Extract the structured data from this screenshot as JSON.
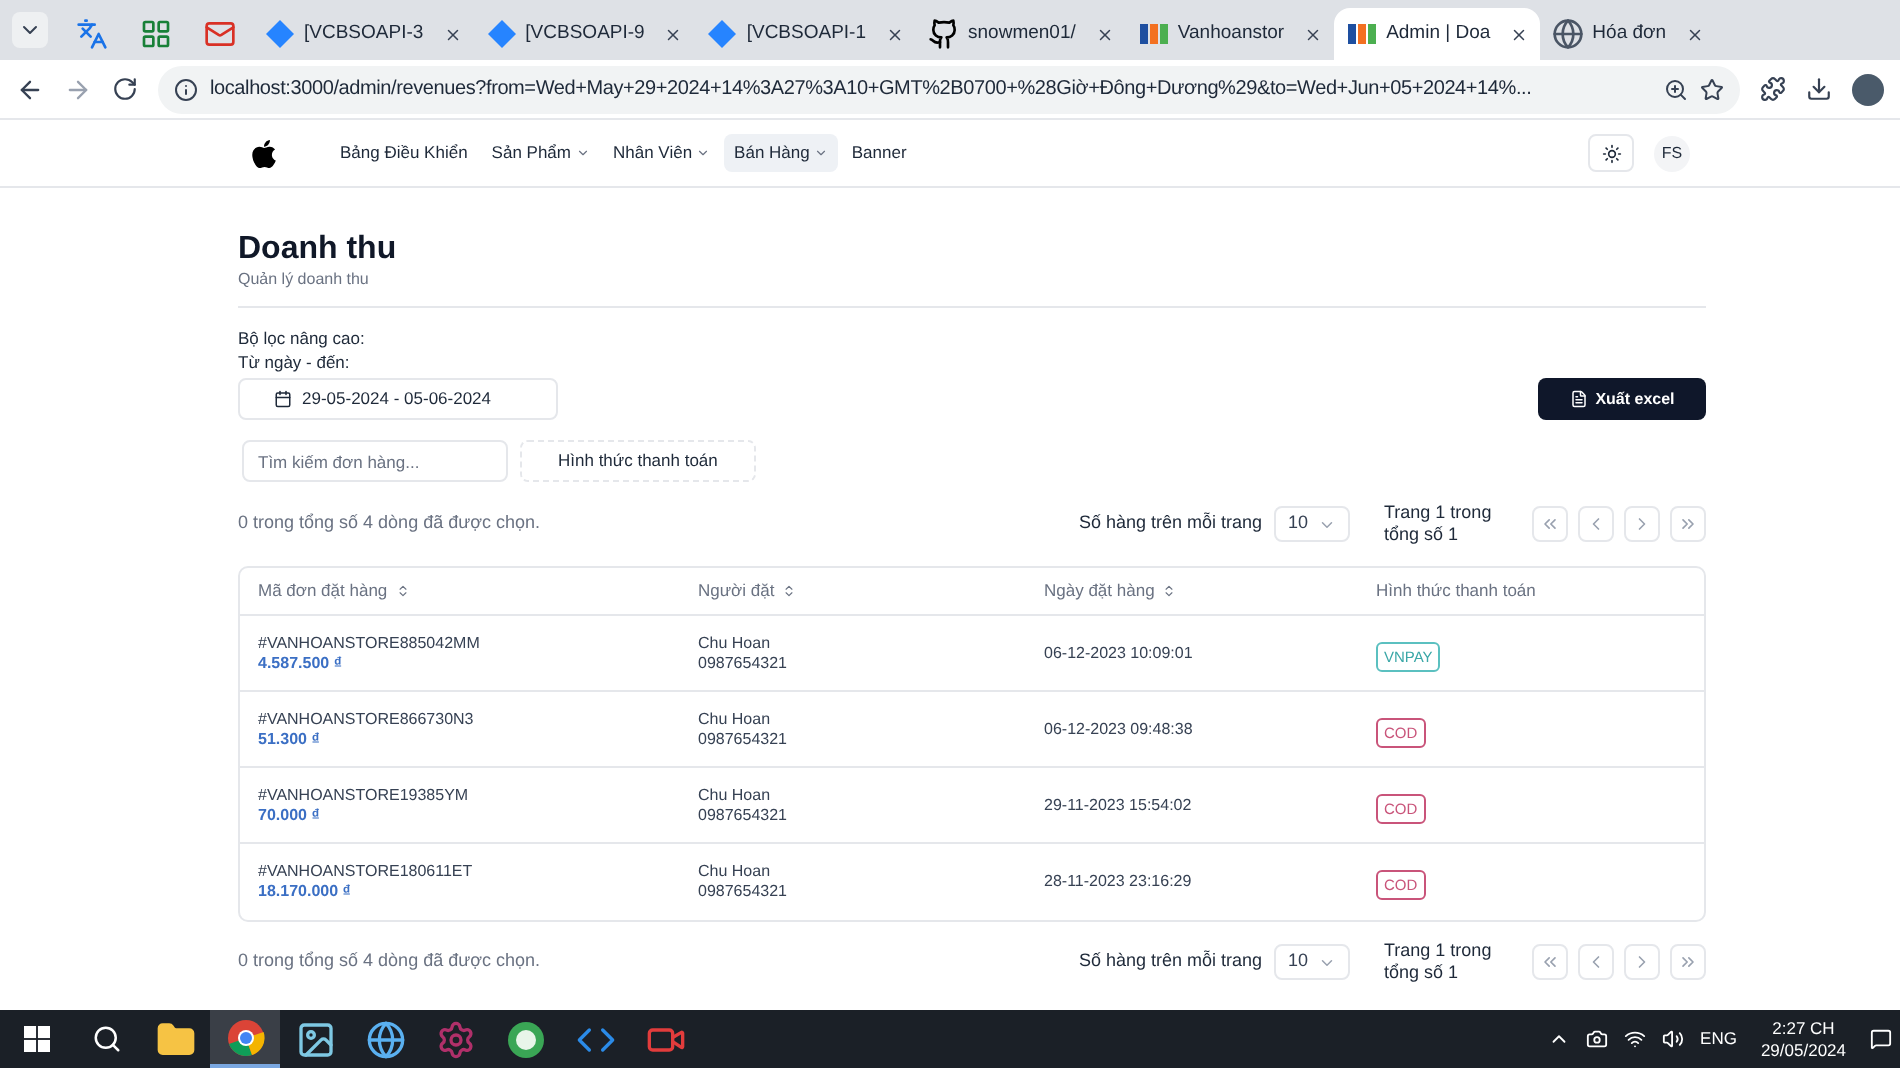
{
  "browser": {
    "tabs": [
      {
        "kind": "translate",
        "selected": false
      },
      {
        "kind": "apps",
        "selected": false
      },
      {
        "kind": "mail",
        "selected": false
      },
      {
        "kind": "diamond",
        "title": "[VCBSOAPI-3",
        "selected": false
      },
      {
        "kind": "diamond",
        "title": "[VCBSOAPI-9",
        "selected": false
      },
      {
        "kind": "diamond",
        "title": "[VCBSOAPI-1",
        "selected": false
      },
      {
        "kind": "github",
        "title": "snowmen01/",
        "selected": false
      },
      {
        "kind": "store",
        "title": "Vanhoanstor",
        "selected": false
      },
      {
        "kind": "store",
        "title": "Admin | Doa",
        "selected": true
      },
      {
        "kind": "globe",
        "title": "Hóa đơn",
        "selected": false
      }
    ],
    "address": "localhost:3000/admin/revenues?from=Wed+May+29+2024+14%3A27%3A10+GMT%2B0700+%28Giờ+Đông+Dương%29&to=Wed+Jun+05+2024+14%..."
  },
  "nav": {
    "items": [
      {
        "label": "Bảng Điều Khiển",
        "dropdown": false,
        "selected": false
      },
      {
        "label": "Sản Phẩm",
        "dropdown": true,
        "selected": false
      },
      {
        "label": "Nhân Viên",
        "dropdown": true,
        "selected": false
      },
      {
        "label": "Bán Hàng",
        "dropdown": true,
        "selected": true
      },
      {
        "label": "Banner",
        "dropdown": false,
        "selected": false
      }
    ],
    "avatar": "FS"
  },
  "header": {
    "title": "Doanh thu",
    "subtitle": "Quản lý doanh thu"
  },
  "filters": {
    "heading": "Bộ lọc nâng cao:",
    "range_label": "Từ ngày - đến:",
    "date_range": "29-05-2024 - 05-06-2024",
    "export_button": "Xuất excel",
    "search": {
      "placeholder": "Tìm kiếm đơn hàng..."
    },
    "payment_filter": "Hình thức thanh toán"
  },
  "pagination_top": {
    "selection": "0 trong tổng số 4 dòng đã được chọn.",
    "rows_label": "Số hàng trên mỗi trang",
    "rows_value": "10",
    "page_line1": "Trang 1 trong",
    "page_line2": "tổng số 1"
  },
  "table": {
    "columns": [
      {
        "label": "Mã đơn đặt hàng",
        "sortable": true
      },
      {
        "label": "Người đặt",
        "sortable": true
      },
      {
        "label": "Ngày đặt hàng",
        "sortable": true
      },
      {
        "label": "Hình thức thanh toán",
        "sortable": false
      }
    ],
    "rows": [
      {
        "order_id": "#VANHOANSTORE885042MM",
        "amount": "4.587.500 ₫",
        "customer": "Chu Hoan",
        "phone": "0987654321",
        "date": "06-12-2023 10:09:01",
        "payment": "VNPAY",
        "kind": "online"
      },
      {
        "order_id": "#VANHOANSTORE866730N3",
        "amount": "51.300 ₫",
        "customer": "Chu Hoan",
        "phone": "0987654321",
        "date": "06-12-2023 09:48:38",
        "payment": "COD",
        "kind": "cash"
      },
      {
        "order_id": "#VANHOANSTORE19385YM",
        "amount": "70.000 ₫",
        "customer": "Chu Hoan",
        "phone": "0987654321",
        "date": "29-11-2023 15:54:02",
        "payment": "COD",
        "kind": "cash"
      },
      {
        "order_id": "#VANHOANSTORE180611ET",
        "amount": "18.170.000 ₫",
        "customer": "Chu Hoan",
        "phone": "0987654321",
        "date": "28-11-2023 23:16:29",
        "payment": "COD",
        "kind": "cash"
      }
    ]
  },
  "pagination_bottom": {
    "selection": "0 trong tổng số 4 dòng đã được chọn.",
    "rows_label": "Số hàng trên mỗi trang",
    "rows_value": "10",
    "page_line1": "Trang 1 trong",
    "page_line2": "tổng số 1"
  },
  "taskbar": {
    "apps": [
      {
        "kind": "folder",
        "selected": false
      },
      {
        "kind": "chrome",
        "selected": true
      },
      {
        "kind": "photo",
        "selected": false
      },
      {
        "kind": "globe",
        "selected": false
      },
      {
        "kind": "gear",
        "selected": false
      },
      {
        "kind": "hs",
        "selected": false
      },
      {
        "kind": "code",
        "selected": false
      },
      {
        "kind": "record",
        "selected": false
      }
    ],
    "language": "ENG",
    "time": "2:27 CH",
    "date": "29/05/2024"
  }
}
